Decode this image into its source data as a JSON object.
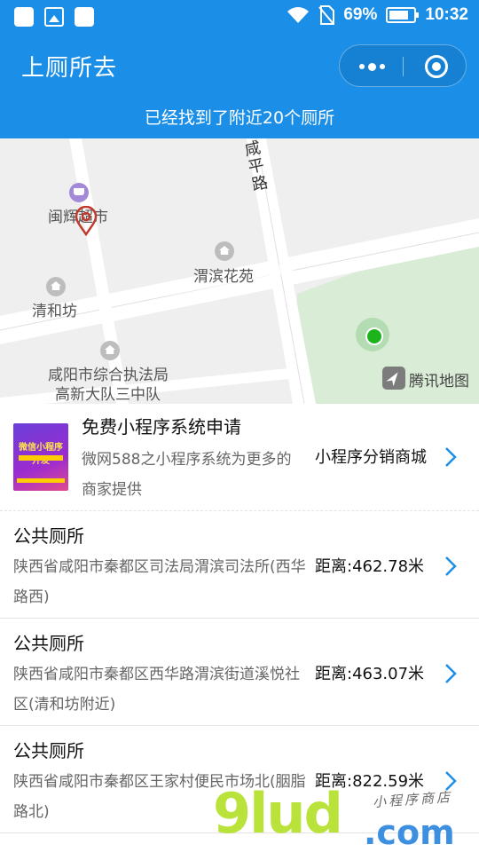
{
  "status_bar": {
    "battery_percent": "69%",
    "time": "10:32"
  },
  "nav": {
    "title": "上厕所去"
  },
  "banner": {
    "text": "已经找到了附近20个厕所"
  },
  "map": {
    "labels": {
      "road_xianping": "咸平路",
      "poi_minhui": "闽辉超市",
      "poi_weibin_huayuan": "渭滨花苑",
      "poi_qinghefang": "清和坊",
      "poi_law_enforcement_line1": "咸阳市综合执法局",
      "poi_law_enforcement_line2": "高新大队三中队",
      "provider": "腾讯地图"
    }
  },
  "ad": {
    "title": "免费小程序系统申请",
    "description": "微网588之小程序系统为更多的商家提供",
    "tag": "小程序分销商城",
    "thumb_text": "微信小程序开发"
  },
  "toilets": [
    {
      "title": "公共厕所",
      "address": "陕西省咸阳市秦都区司法局渭滨司法所(西华路西)",
      "distance": "距离:462.78米"
    },
    {
      "title": "公共厕所",
      "address": "陕西省咸阳市秦都区西华路渭滨街道溪悦社区(清和坊附近)",
      "distance": "距离:463.07米"
    },
    {
      "title": "公共厕所",
      "address": "陕西省咸阳市秦都区王家村便民市场北(胭脂路北)",
      "distance": "距离:822.59米"
    }
  ],
  "watermark": {
    "big": "9lud",
    "com": ".com",
    "small": "小程序商店"
  },
  "colors": {
    "primary": "#1b8fe8",
    "chevron": "#1b8fe8",
    "location_green": "#1db31d",
    "park_green": "#d9ecd6"
  }
}
